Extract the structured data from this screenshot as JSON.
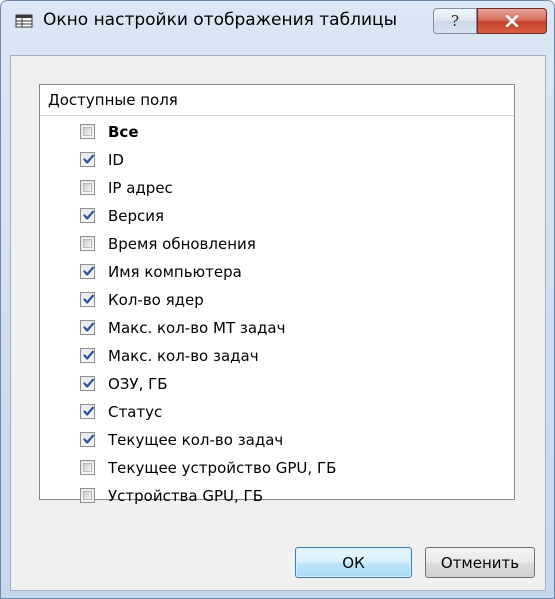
{
  "window": {
    "title": "Окно настройки отображения таблицы",
    "help_glyph": "?",
    "app_icon": "table-settings-icon",
    "close_icon": "close-icon"
  },
  "list": {
    "header": "Доступные поля",
    "items": [
      {
        "label": "Все",
        "checked": false,
        "bold": true
      },
      {
        "label": "ID",
        "checked": true,
        "bold": false
      },
      {
        "label": "IP адрес",
        "checked": false,
        "bold": false
      },
      {
        "label": "Версия",
        "checked": true,
        "bold": false
      },
      {
        "label": "Время обновления",
        "checked": false,
        "bold": false
      },
      {
        "label": "Имя компьютера",
        "checked": true,
        "bold": false
      },
      {
        "label": "Кол-во ядер",
        "checked": true,
        "bold": false
      },
      {
        "label": "Макс. кол-во МТ задач",
        "checked": true,
        "bold": false
      },
      {
        "label": "Макс. кол-во задач",
        "checked": true,
        "bold": false
      },
      {
        "label": "ОЗУ, ГБ",
        "checked": true,
        "bold": false
      },
      {
        "label": "Статус",
        "checked": true,
        "bold": false
      },
      {
        "label": "Текущее кол-во задач",
        "checked": true,
        "bold": false
      },
      {
        "label": "Текущее устройство GPU, ГБ",
        "checked": false,
        "bold": false
      },
      {
        "label": "Устройства GPU, ГБ",
        "checked": false,
        "bold": false
      }
    ]
  },
  "buttons": {
    "ok_label": "ОК",
    "cancel_label": "Отменить"
  },
  "colors": {
    "checkmark": "#2a51a8",
    "ok_border": "#3c7fb1",
    "close_button": "#c3412a"
  }
}
